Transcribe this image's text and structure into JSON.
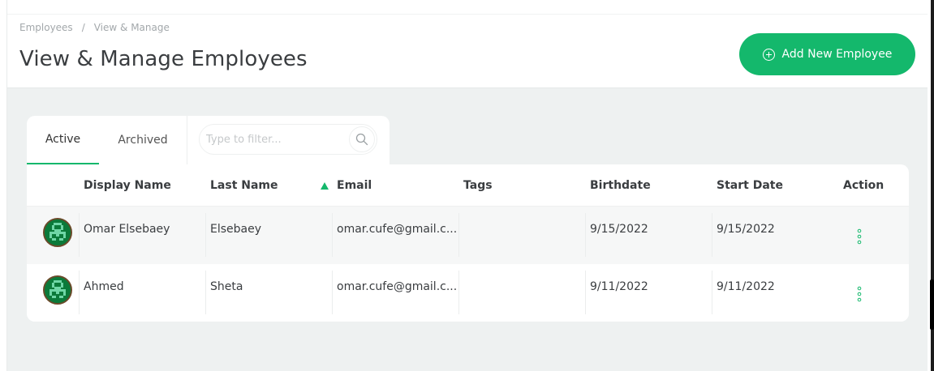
{
  "breadcrumb": {
    "items": [
      "Employees",
      "View & Manage"
    ],
    "separator": "/"
  },
  "page": {
    "title": "View & Manage Employees"
  },
  "actions": {
    "add_employee_label": "Add New Employee"
  },
  "tabs": [
    {
      "label": "Active",
      "active": true
    },
    {
      "label": "Archived",
      "active": false
    }
  ],
  "filter": {
    "placeholder": "Type to filter...",
    "value": ""
  },
  "table": {
    "columns": [
      "Display Name",
      "Last Name",
      "Email",
      "Tags",
      "Birthdate",
      "Start Date",
      "Action"
    ],
    "sort": {
      "column": "Email",
      "direction": "ascending"
    },
    "rows": [
      {
        "display_name": "Omar Elsebaey",
        "last_name": "Elsebaey",
        "email": "omar.cufe@gmail.c...",
        "tags": "",
        "birthdate": "9/15/2022",
        "start_date": "9/15/2022"
      },
      {
        "display_name": "Ahmed",
        "last_name": "Sheta",
        "email": "omar.cufe@gmail.c...",
        "tags": "",
        "birthdate": "9/11/2022",
        "start_date": "9/11/2022"
      }
    ]
  },
  "colors": {
    "accent": "#14b86c",
    "background": "#eef1f1",
    "text": "#3a3d40"
  }
}
